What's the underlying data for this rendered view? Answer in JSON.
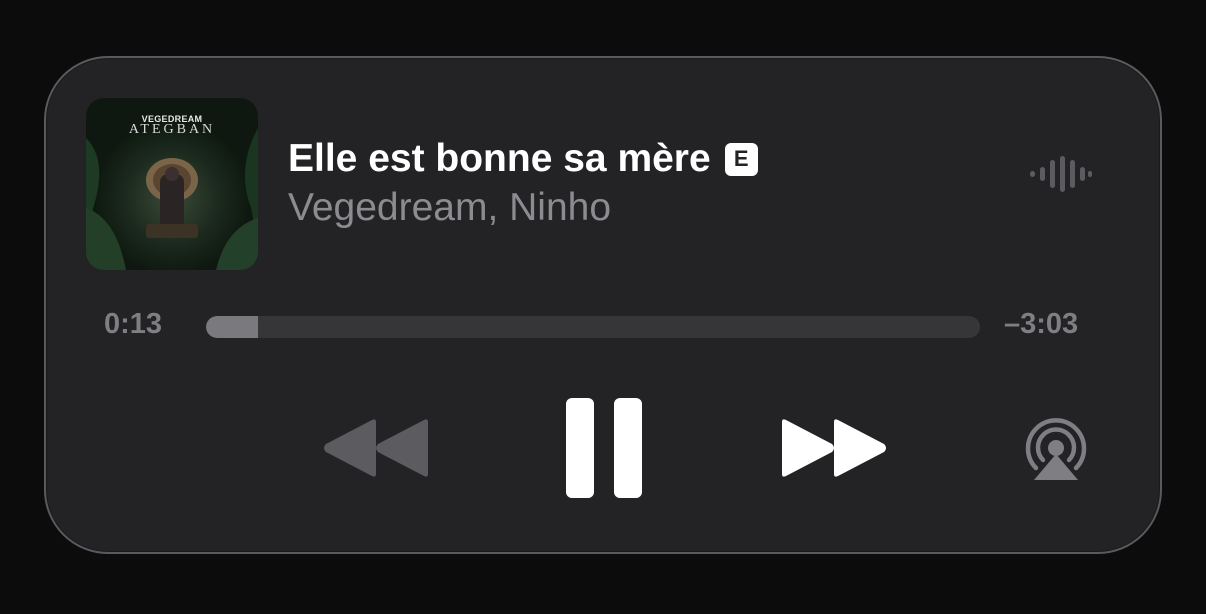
{
  "track": {
    "title": "Elle est bonne sa mère",
    "explicit_badge": "E",
    "artist": "Vegedream, Ninho"
  },
  "artwork": {
    "artist_text": "VEGEDREAM",
    "album_text": "ATEGBAN"
  },
  "playback": {
    "elapsed": "0:13",
    "remaining": "–3:03",
    "progress_fraction": 0.067,
    "state": "playing"
  },
  "icons": {
    "waveform": "waveform-icon",
    "rewind": "rewind-icon",
    "pause": "pause-icon",
    "forward": "fast-forward-icon",
    "airplay": "airplay-audio-icon"
  },
  "colors": {
    "background": "#0c0c0d",
    "panel": "#232325",
    "primary_text": "#ffffff",
    "secondary_text": "#8c8c90",
    "disabled_control": "#5c5c60"
  }
}
